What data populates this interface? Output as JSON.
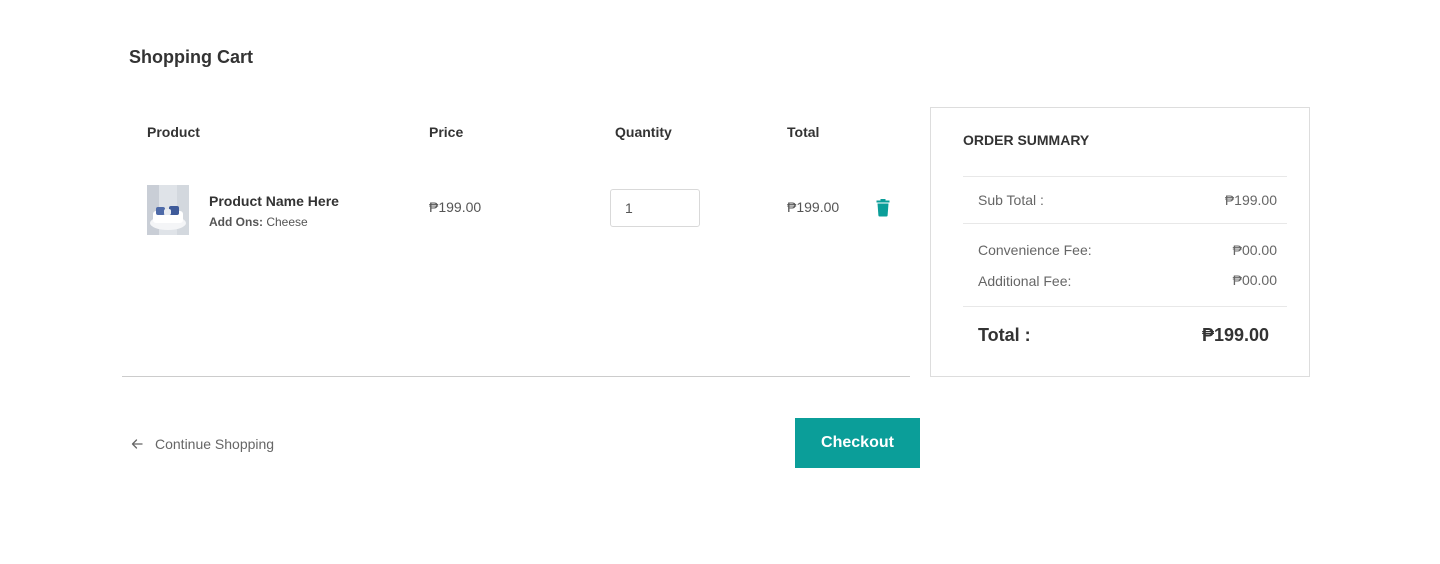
{
  "page": {
    "title": "Shopping Cart"
  },
  "cart": {
    "headers": {
      "product": "Product",
      "price": "Price",
      "quantity": "Quantity",
      "total": "Total"
    },
    "items": [
      {
        "name": "Product Name Here",
        "addons_label": "Add Ons:",
        "addons_value": "Cheese",
        "price": "₱199.00",
        "quantity": "1",
        "total": "₱199.00",
        "delete_icon": "trash-icon"
      }
    ]
  },
  "summary": {
    "title": "ORDER SUMMARY",
    "subtotal_label": "Sub Total :",
    "subtotal_value": "₱199.00",
    "convenience_label": "Convenience Fee:",
    "convenience_value": "₱00.00",
    "additional_label": "Additional Fee:",
    "additional_value": "₱00.00",
    "total_label": "Total :",
    "total_value": "₱199.00"
  },
  "actions": {
    "continue_label": "Continue Shopping",
    "continue_icon": "arrow-left-icon",
    "checkout_label": "Checkout"
  },
  "colors": {
    "accent": "#0b9e99",
    "text": "#333333",
    "muted": "#666666"
  }
}
